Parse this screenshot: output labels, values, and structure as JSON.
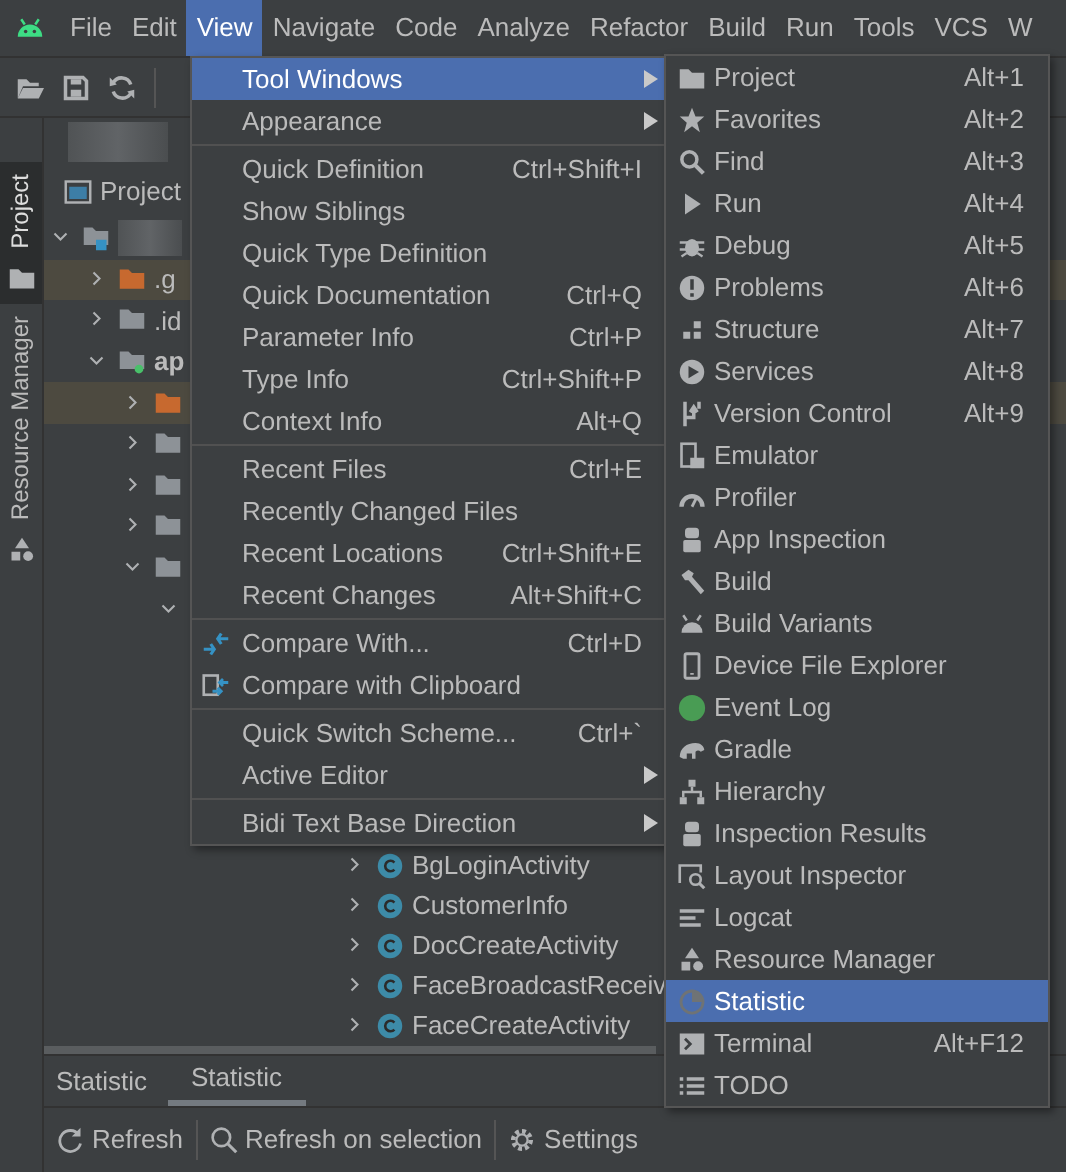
{
  "menubar": [
    {
      "label": "File",
      "selected": false
    },
    {
      "label": "Edit",
      "selected": false
    },
    {
      "label": "View",
      "selected": true
    },
    {
      "label": "Navigate",
      "selected": false
    },
    {
      "label": "Code",
      "selected": false
    },
    {
      "label": "Analyze",
      "selected": false
    },
    {
      "label": "Refactor",
      "selected": false
    },
    {
      "label": "Build",
      "selected": false
    },
    {
      "label": "Run",
      "selected": false
    },
    {
      "label": "Tools",
      "selected": false
    },
    {
      "label": "VCS",
      "selected": false
    },
    {
      "label": "W",
      "selected": false
    }
  ],
  "left_stripe": [
    {
      "label": "Project",
      "selected": true
    },
    {
      "label": "Resource Manager",
      "selected": false
    }
  ],
  "project_panel": {
    "title": "Project",
    "tree": [
      {
        "kind": "project",
        "expanded": true,
        "ignored": false,
        "children": [
          {
            "kind": "folder",
            "label": ".g",
            "expanded": false,
            "ignored": true
          },
          {
            "kind": "folder",
            "label": ".id",
            "expanded": false,
            "ignored": false
          },
          {
            "kind": "module",
            "label": "ap",
            "expanded": true,
            "ignored": false,
            "children": [
              {
                "kind": "folder",
                "expanded": false,
                "ignored": true
              },
              {
                "kind": "folder",
                "expanded": false,
                "ignored": false
              },
              {
                "kind": "folder",
                "expanded": false,
                "ignored": false
              },
              {
                "kind": "folder",
                "expanded": false,
                "ignored": false
              },
              {
                "kind": "folder",
                "expanded": true,
                "ignored": false,
                "children": [
                  {
                    "expanded": true,
                    "ignored": false
                  }
                ]
              }
            ]
          }
        ]
      }
    ],
    "lower_items": [
      {
        "kind": "class",
        "label": "BgLoginActivity",
        "expanded": false
      },
      {
        "kind": "class",
        "label": "CustomerInfo",
        "expanded": false
      },
      {
        "kind": "class",
        "label": "DocCreateActivity",
        "expanded": false
      },
      {
        "kind": "class",
        "label": "FaceBroadcastReceiv",
        "expanded": false
      },
      {
        "kind": "class",
        "label": "FaceCreateActivity",
        "expanded": false
      }
    ]
  },
  "view_menu": {
    "groups": [
      [
        {
          "label": "Tool Windows",
          "selected": true,
          "submenu": true
        },
        {
          "label": "Appearance",
          "selected": false,
          "submenu": true
        }
      ],
      [
        {
          "label": "Quick Definition",
          "shortcut": "Ctrl+Shift+I",
          "selected": false,
          "submenu": false
        },
        {
          "label": "Show Siblings",
          "selected": false,
          "submenu": false
        },
        {
          "label": "Quick Type Definition",
          "selected": false,
          "submenu": false
        },
        {
          "label": "Quick Documentation",
          "shortcut": "Ctrl+Q",
          "selected": false,
          "submenu": false
        },
        {
          "label": "Parameter Info",
          "shortcut": "Ctrl+P",
          "selected": false,
          "submenu": false
        },
        {
          "label": "Type Info",
          "shortcut": "Ctrl+Shift+P",
          "selected": false,
          "submenu": false
        },
        {
          "label": "Context Info",
          "shortcut": "Alt+Q",
          "selected": false,
          "submenu": false
        }
      ],
      [
        {
          "label": "Recent Files",
          "shortcut": "Ctrl+E",
          "selected": false,
          "submenu": false
        },
        {
          "label": "Recently Changed Files",
          "selected": false,
          "submenu": false
        },
        {
          "label": "Recent Locations",
          "shortcut": "Ctrl+Shift+E",
          "selected": false,
          "submenu": false
        },
        {
          "label": "Recent Changes",
          "shortcut": "Alt+Shift+C",
          "selected": false,
          "submenu": false
        }
      ],
      [
        {
          "label": "Compare With...",
          "shortcut": "Ctrl+D",
          "selected": false,
          "submenu": false
        },
        {
          "label": "Compare with Clipboard",
          "selected": false,
          "submenu": false
        }
      ],
      [
        {
          "label": "Quick Switch Scheme...",
          "shortcut": "Ctrl+`",
          "selected": false,
          "submenu": false
        },
        {
          "label": "Active Editor",
          "selected": false,
          "submenu": true
        }
      ],
      [
        {
          "label": "Bidi Text Base Direction",
          "selected": false,
          "submenu": true
        }
      ]
    ]
  },
  "tool_windows_menu": {
    "items": [
      {
        "label": "Project",
        "shortcut": "Alt+1",
        "selected": false
      },
      {
        "label": "Favorites",
        "shortcut": "Alt+2",
        "selected": false
      },
      {
        "label": "Find",
        "shortcut": "Alt+3",
        "selected": false
      },
      {
        "label": "Run",
        "shortcut": "Alt+4",
        "selected": false
      },
      {
        "label": "Debug",
        "shortcut": "Alt+5",
        "selected": false
      },
      {
        "label": "Problems",
        "shortcut": "Alt+6",
        "selected": false
      },
      {
        "label": "Structure",
        "shortcut": "Alt+7",
        "selected": false
      },
      {
        "label": "Services",
        "shortcut": "Alt+8",
        "selected": false
      },
      {
        "label": "Version Control",
        "shortcut": "Alt+9",
        "selected": false
      },
      {
        "label": "Emulator",
        "selected": false
      },
      {
        "label": "Profiler",
        "selected": false
      },
      {
        "label": "App Inspection",
        "selected": false
      },
      {
        "label": "Build",
        "selected": false
      },
      {
        "label": "Build Variants",
        "selected": false
      },
      {
        "label": "Device File Explorer",
        "selected": false
      },
      {
        "label": "Event Log",
        "selected": false
      },
      {
        "label": "Gradle",
        "selected": false
      },
      {
        "label": "Hierarchy",
        "selected": false
      },
      {
        "label": "Inspection Results",
        "selected": false
      },
      {
        "label": "Layout Inspector",
        "selected": false
      },
      {
        "label": "Logcat",
        "selected": false
      },
      {
        "label": "Resource Manager",
        "selected": false
      },
      {
        "label": "Statistic",
        "selected": true
      },
      {
        "label": "Terminal",
        "shortcut": "Alt+F12",
        "selected": false
      },
      {
        "label": "TODO",
        "selected": false
      }
    ]
  },
  "bottom_panel": {
    "title": "Statistic",
    "tabs": [
      {
        "label": "Statistic",
        "selected": true
      }
    ],
    "toolbar": [
      {
        "label": "Refresh"
      },
      {
        "label": "Refresh on selection"
      },
      {
        "label": "Settings"
      }
    ]
  }
}
